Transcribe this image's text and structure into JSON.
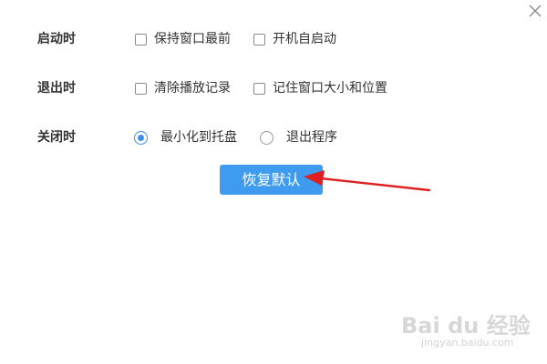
{
  "window": {
    "close_icon": "close-icon"
  },
  "settings": {
    "startup": {
      "label": "启动时",
      "options": [
        {
          "label": "保持窗口最前",
          "checked": false
        },
        {
          "label": "开机自启动",
          "checked": false
        }
      ]
    },
    "exit": {
      "label": "退出时",
      "options": [
        {
          "label": "清除播放记录",
          "checked": false
        },
        {
          "label": "记住窗口大小和位置",
          "checked": false
        }
      ]
    },
    "close": {
      "label": "关闭时",
      "options": [
        {
          "label": "最小化到托盘",
          "selected": true
        },
        {
          "label": "退出程序",
          "selected": false
        }
      ]
    }
  },
  "restore_button": {
    "label": "恢复默认"
  },
  "annotation": {
    "arrow_color": "#e02020"
  },
  "watermark": {
    "logo": "Bai du 经验",
    "url": "jingyan.baidu.com"
  },
  "colors": {
    "accent": "#3e9bf0",
    "radio_selected": "#3d8fe8"
  }
}
